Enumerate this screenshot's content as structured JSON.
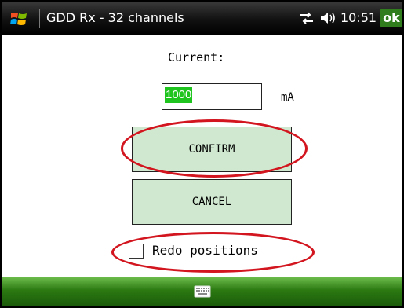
{
  "titlebar": {
    "title": "GDD Rx - 32 channels",
    "time": "10:51",
    "ok_label": "ok",
    "logo_icon": "windows-flag-icon",
    "connectivity_icon": "connectivity-arrows-icon",
    "volume_icon": "speaker-icon"
  },
  "form": {
    "current_label": "Current:",
    "current_value": "1000",
    "unit": "mA",
    "confirm_label": "CONFIRM",
    "cancel_label": "CANCEL",
    "redo_label": "Redo positions",
    "redo_checked": false
  },
  "bottombar": {
    "keyboard_icon": "keyboard-icon"
  },
  "colors": {
    "titlebar_bg": "#111111",
    "button_bg": "#cfe8cf",
    "selection_green": "#1fc41f",
    "annotation_red": "#d2151e",
    "ok_green": "#2f7d1c",
    "bottombar_green": "#2c7a12"
  }
}
